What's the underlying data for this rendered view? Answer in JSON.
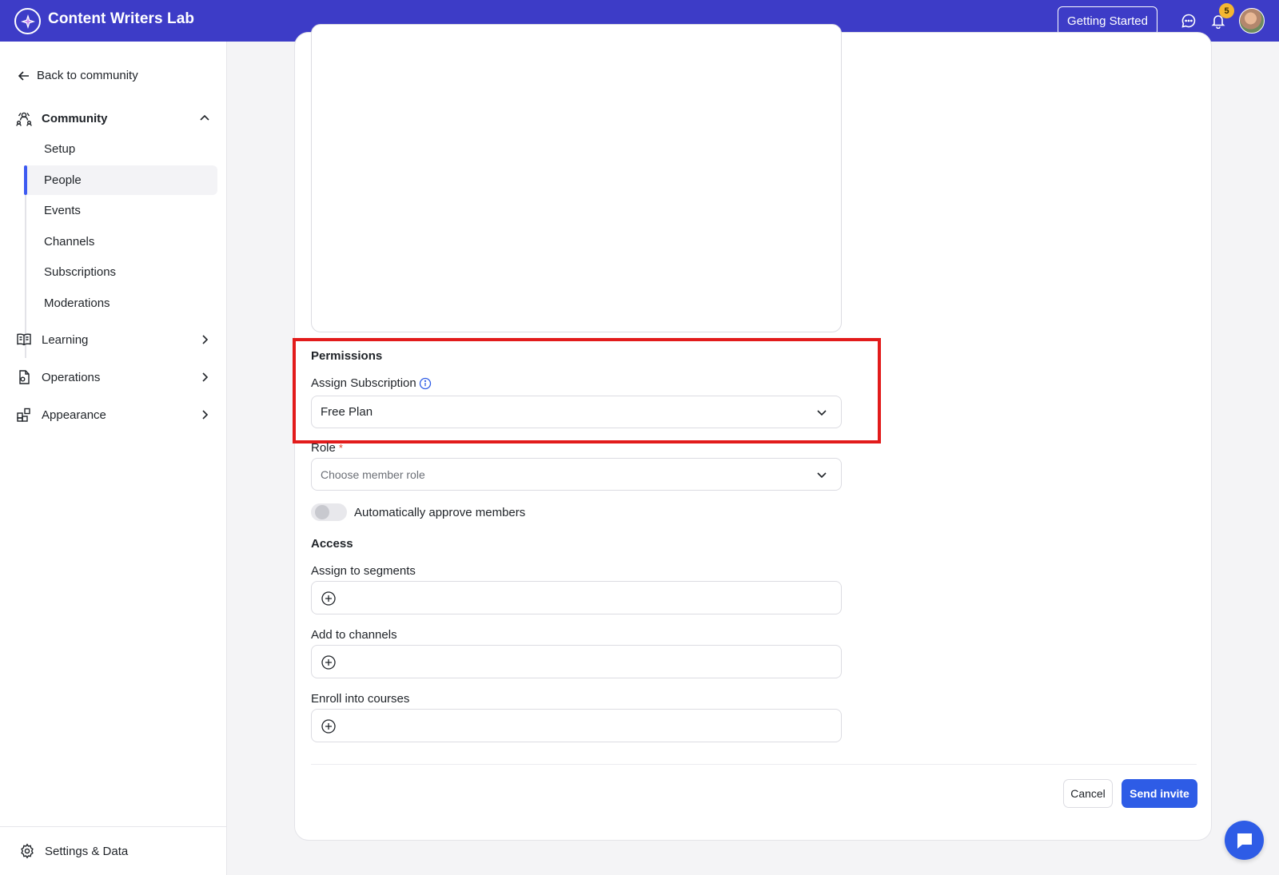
{
  "app": {
    "name": "Content Writers Lab",
    "getting_started_label": "Getting Started",
    "notification_count": "5"
  },
  "sidebar": {
    "back_label": "Back to community",
    "community": {
      "label": "Community",
      "items": [
        "Setup",
        "People",
        "Events",
        "Channels",
        "Subscriptions",
        "Moderations"
      ],
      "active": "People"
    },
    "groups": [
      {
        "label": "Learning",
        "icon": "book-icon"
      },
      {
        "label": "Operations",
        "icon": "document-icon"
      },
      {
        "label": "Appearance",
        "icon": "blocks-icon"
      }
    ],
    "settings_label": "Settings & Data"
  },
  "form": {
    "permissions_title": "Permissions",
    "assign_subscription_label": "Assign Subscription",
    "subscription_value": "Free Plan",
    "role_label": "Role",
    "role_required_mark": "*",
    "role_placeholder": "Choose member role",
    "auto_approve_label": "Automatically approve members",
    "auto_approve_on": false,
    "access_title": "Access",
    "segments_label": "Assign to segments",
    "channels_label": "Add to channels",
    "courses_label": "Enroll into courses",
    "cancel_label": "Cancel",
    "send_label": "Send invite"
  },
  "colors": {
    "topbar": "#3d3cc7",
    "primary_button": "#2e5ce6",
    "highlight": "#e21b1b",
    "badge": "#f4b731"
  }
}
